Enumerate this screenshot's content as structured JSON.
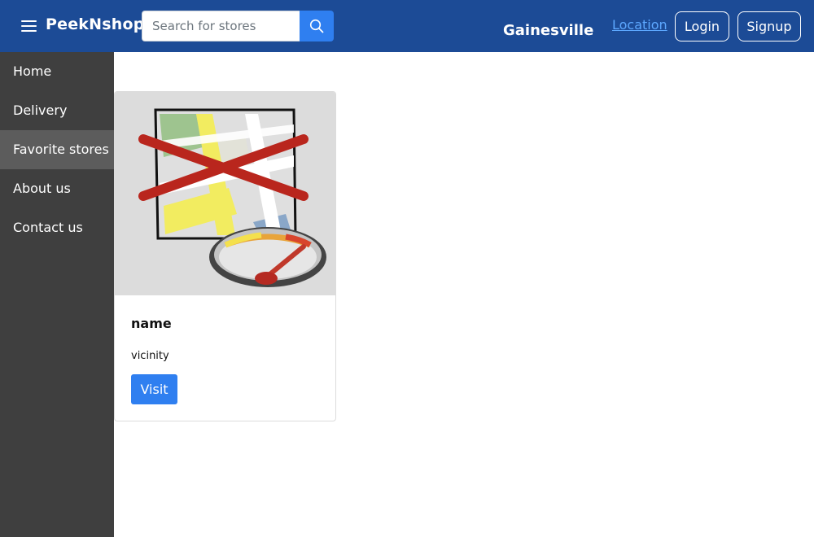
{
  "header": {
    "brand": "PeekNshop",
    "search": {
      "placeholder": "Search for stores",
      "value": ""
    },
    "city": "Gainesville",
    "location_link": "Location",
    "login": "Login",
    "signup": "Signup"
  },
  "sidebar": {
    "items": [
      {
        "label": "Home"
      },
      {
        "label": "Delivery"
      },
      {
        "label": "Favorite stores"
      },
      {
        "label": "About us"
      },
      {
        "label": "Contact us"
      }
    ],
    "active": "Favorite stores"
  },
  "store_card": {
    "image_icon": "broken-map-image-icon",
    "title": "name",
    "subtitle": "vicinity",
    "button": "Visit"
  },
  "colors": {
    "header_bg": "#1c4b96",
    "sidebar_bg": "#3f3f3f",
    "sidebar_active": "#5c5c5c",
    "accent": "#2f7ff0",
    "link": "#5da8ff"
  }
}
